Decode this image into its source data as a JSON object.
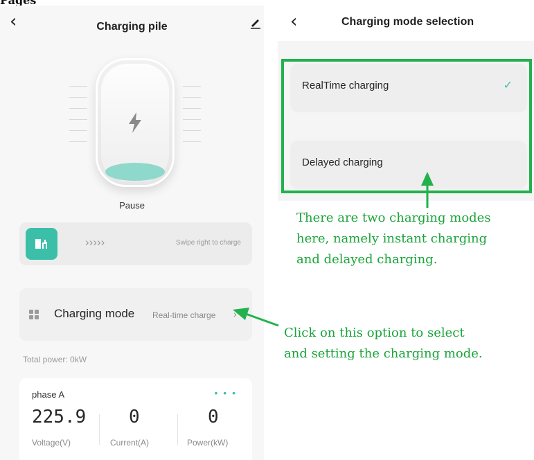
{
  "left_screen": {
    "header": {
      "title": "Charging pile",
      "back_icon": "chevron-left-icon",
      "edit_icon": "pen-icon"
    },
    "status_label": "Pause",
    "swipe": {
      "arrows": "›››››",
      "hint": "Swipe right to charge",
      "handle_icon": "charge-plug-icon"
    },
    "charging_mode": {
      "label": "Charging mode",
      "value": "Real-time charge",
      "chevron": "›"
    },
    "total_power": "Total power: 0kW",
    "phase": {
      "title": "phase A",
      "metrics": [
        {
          "value": "225.9",
          "label": "Voltage(V)"
        },
        {
          "value": "0",
          "label": "Current(A)"
        },
        {
          "value": "0",
          "label": "Power(kW)"
        }
      ]
    }
  },
  "right_screen": {
    "header": {
      "title": "Charging mode selection",
      "back_icon": "chevron-left-icon"
    },
    "options": [
      {
        "label": "RealTime charging",
        "selected": true,
        "check": "✓"
      },
      {
        "label": "Delayed charging",
        "selected": false
      }
    ]
  },
  "annotations": {
    "modes_note": [
      "There are two charging modes",
      "here, namely instant charging",
      "and delayed charging."
    ],
    "click_note": [
      "Click on this option to select",
      "and setting the charging mode."
    ],
    "color": "#23b14d"
  },
  "colors": {
    "accent": "#3cbfa9",
    "annotation": "#23b14d"
  }
}
